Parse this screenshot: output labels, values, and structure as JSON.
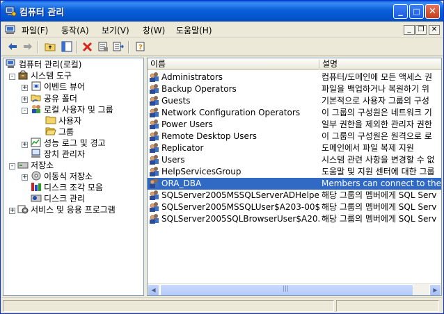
{
  "window": {
    "title": "컴퓨터 관리",
    "minimize": "_",
    "maximize": "□",
    "close": "✕"
  },
  "menu": {
    "items": [
      "파일(F)",
      "동작(A)",
      "보기(V)",
      "창(W)",
      "도움말(H)"
    ],
    "mdi_min": "_",
    "mdi_restore": "❐",
    "mdi_close": "✕"
  },
  "toolbar": {
    "icons": [
      "back-arrow-icon",
      "forward-arrow-icon",
      "up-folder-icon",
      "show-tree-icon",
      "delete-icon",
      "properties-icon",
      "export-list-icon",
      "help-icon"
    ]
  },
  "tree": {
    "root": "컴퓨터 관리(로컬)",
    "system_tools": "시스템 도구",
    "event_viewer": "이벤트 뷰어",
    "shared_folders": "공유 폴더",
    "local_users_groups": "로컬 사용자 및 그룹",
    "users": "사용자",
    "groups": "그룹",
    "perf_logs": "성능 로그 및 경고",
    "device_manager": "장치 관리자",
    "storage": "저장소",
    "removable_storage": "이동식 저장소",
    "defrag": "디스크 조각 모음",
    "disk_mgmt": "디스크 관리",
    "services_apps": "서비스 및 응용 프로그램",
    "expand_plus": "+",
    "expand_minus": "-"
  },
  "list": {
    "columns": [
      "이름",
      "설명"
    ],
    "rows": [
      {
        "name": "Administrators",
        "desc": "컴퓨터/도메인에 모든 액세스 권"
      },
      {
        "name": "Backup Operators",
        "desc": "파일을 백업하거나 복원하기 위"
      },
      {
        "name": "Guests",
        "desc": "기본적으로 사용자 그룹의 구성"
      },
      {
        "name": "Network Configuration Operators",
        "desc": "이 그룹의 구성원은 네트워크 기"
      },
      {
        "name": "Power Users",
        "desc": "일부 권한을 제외한 관리자 권한"
      },
      {
        "name": "Remote Desktop Users",
        "desc": "이 그룹의 구성원은 원격으로 로"
      },
      {
        "name": "Replicator",
        "desc": "도메인에서 파일 복제 지원"
      },
      {
        "name": "Users",
        "desc": "시스템 관련 사항을 변경할 수 없"
      },
      {
        "name": "HelpServicesGroup",
        "desc": "도움말 및 지원 센터에 대한 그룹"
      },
      {
        "name": "ORA_DBA",
        "desc": "Members can connect to the C"
      },
      {
        "name": "SQLServer2005MSSQLServerADHelpe...",
        "desc": "해당 그룹의 멤버에게 SQL Serv"
      },
      {
        "name": "SQLServer2005MSSQLUser$A203-00$...",
        "desc": "해당 그룹의 멤버에게 SQL Serv"
      },
      {
        "name": "SQLServer2005SQLBrowserUser$A20...",
        "desc": "해당 그룹의 멤버에게 SQL Serv"
      }
    ],
    "selected_index": 9
  },
  "scrollbar": {
    "left_arrow": "◀",
    "right_arrow": "▶",
    "grip": "|||"
  },
  "colors": {
    "titlebar": "#0a5fd8",
    "selection": "#316ac5",
    "delete_icon": "#d9261c"
  }
}
